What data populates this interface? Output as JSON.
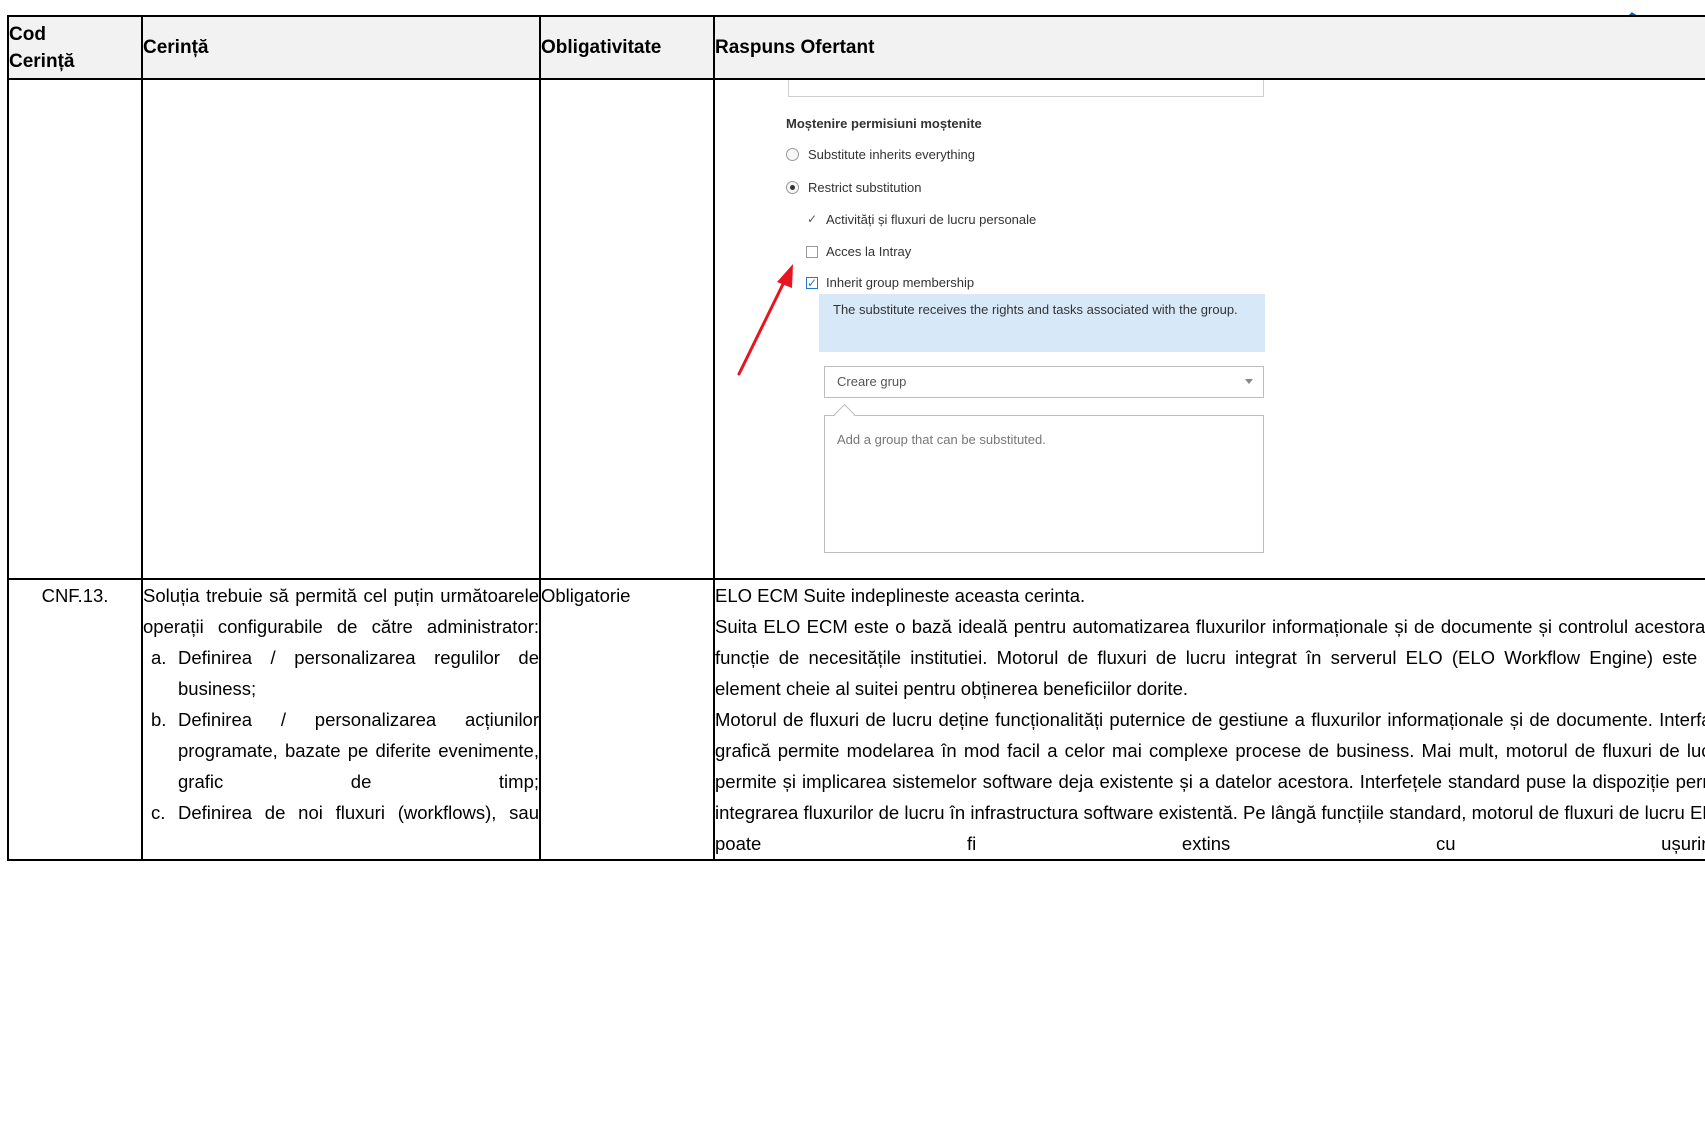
{
  "table": {
    "headers": {
      "code": "Cod\nCerință",
      "requirement": "Cerință",
      "mandatory": "Obligativitate",
      "response": "Raspuns Ofertant"
    }
  },
  "screenshot": {
    "section_title": "Moștenire permisiuni moștenite",
    "radio_inherit_everything": "Substitute inherits everything",
    "radio_restrict": "Restrict substitution",
    "check_activities": "Activități și fluxuri de lucru personale",
    "check_intray": "Acces la Intray",
    "check_group": "Inherit group membership",
    "info_text": "The substitute receives the rights and tasks associated with the group.",
    "select_value": "Creare grup",
    "textarea_placeholder": "Add a group that can be substituted."
  },
  "row": {
    "code": "CNF.13.",
    "requirement_intro": "Soluția trebuie să permită cel puțin următoarele operații configurabile de către administrator:",
    "items": [
      {
        "marker": "a.",
        "text": "Definirea / personalizarea regulilor de business;"
      },
      {
        "marker": "b.",
        "text": "Definirea / personalizarea acțiunilor programate, bazate pe diferite evenimente, grafic de timp;"
      },
      {
        "marker": "c.",
        "text": "Definirea de noi fluxuri (workflows), sau"
      }
    ],
    "mandatory": "Obligatorie",
    "response": [
      "ELO ECM Suite indeplineste aceasta cerinta.",
      "Suita ELO ECM este o bază ideală pentru automatizarea fluxurilor informaționale și de documente și controlul acestora în funcție de necesitățile institutiei. Motorul de fluxuri de lucru integrat în serverul ELO (ELO Workflow Engine) este un element cheie al suitei pentru obținerea beneficiilor dorite.",
      "Motorul de fluxuri de lucru deține funcționalități puternice de gestiune a fluxurilor informaționale și de documente. Interfața grafică permite modelarea în mod facil a celor mai complexe procese de business. Mai mult, motorul de fluxuri de lucru permite și implicarea sistemelor software deja existente și a datelor acestora. Interfețele standard puse la dispoziție permit integrarea fluxurilor de lucru în infrastructura software existentă. Pe lângă funcțiile standard, motorul de fluxuri de lucru ELO poate fi extins cu ușurință"
    ]
  },
  "colors": {
    "header_bg": "#f2f2f2",
    "info_box": "#d7e9f8",
    "arrow": "#e8141e",
    "checkbox_blue": "#2a77c9"
  }
}
